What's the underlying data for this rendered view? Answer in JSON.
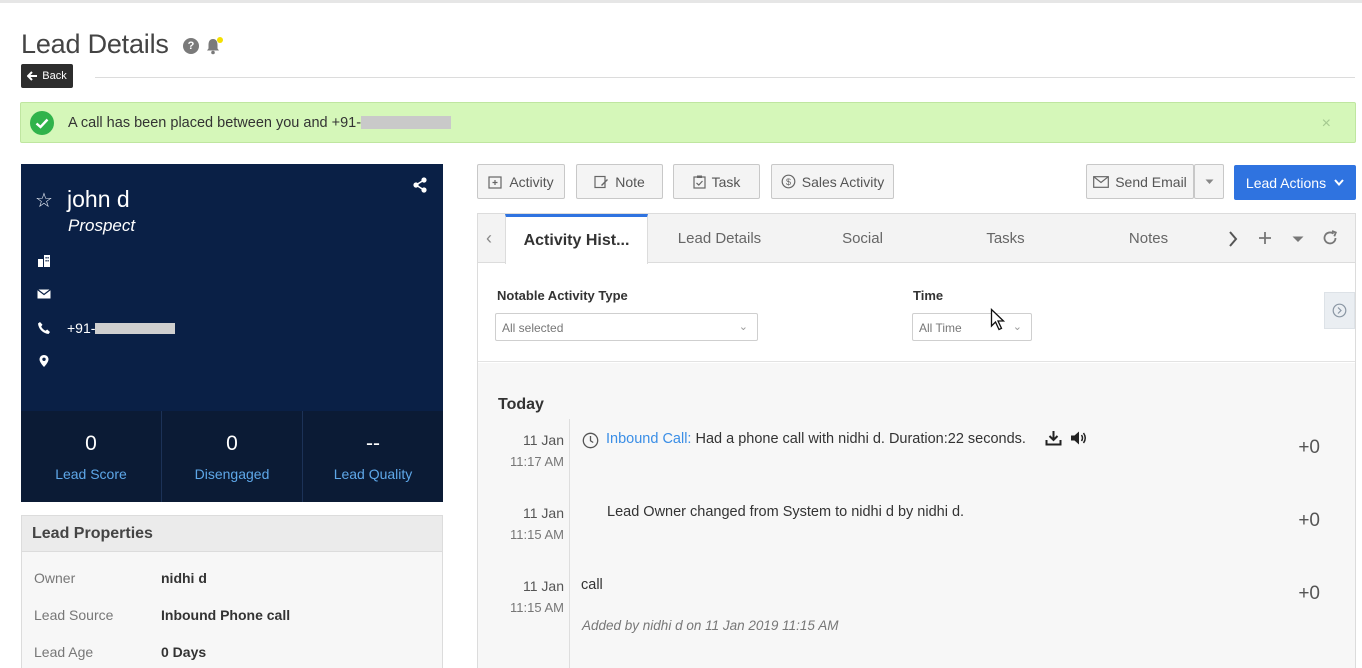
{
  "page": {
    "title": "Lead Details",
    "back_label": "Back"
  },
  "alert": {
    "message": "A call has been placed between you and +91-",
    "close": "×"
  },
  "profile": {
    "name": "john d",
    "stage": "Prospect",
    "phone_prefix": "+91-",
    "stats": [
      {
        "value": "0",
        "label": "Lead Score"
      },
      {
        "value": "0",
        "label": "Disengaged"
      },
      {
        "value": "--",
        "label": "Lead Quality"
      }
    ]
  },
  "properties": {
    "heading": "Lead Properties",
    "rows": [
      {
        "key": "Owner",
        "value": "nidhi d"
      },
      {
        "key": "Lead Source",
        "value": "Inbound Phone call"
      },
      {
        "key": "Lead Age",
        "value": "0 Days"
      }
    ]
  },
  "toolbar": {
    "activity": "Activity",
    "note": "Note",
    "task": "Task",
    "sales_activity": "Sales Activity",
    "send_email": "Send Email",
    "lead_actions": "Lead Actions"
  },
  "tabs": [
    "Activity Hist...",
    "Lead Details",
    "Social",
    "Tasks",
    "Notes"
  ],
  "filters": {
    "type_label": "Notable Activity Type",
    "type_value": "All selected",
    "time_label": "Time",
    "time_value": "All Time"
  },
  "feed": {
    "heading": "Today",
    "items": [
      {
        "date": "11 Jan",
        "time": "11:17 AM",
        "link": "Inbound Call:",
        "text": " Had a phone call with nidhi d. Duration:22 seconds.",
        "score": "+0"
      },
      {
        "date": "11 Jan",
        "time": "11:15 AM",
        "text": "Lead Owner changed from System to nidhi d by nidhi d.",
        "score": "+0"
      },
      {
        "date": "11 Jan",
        "time": "11:15 AM",
        "text": "call",
        "meta": "Added by nidhi d on 11 Jan 2019 11:15 AM",
        "score": "+0"
      }
    ]
  },
  "colors": {
    "profile_bg": "#0a2046",
    "accent": "#2f73e0",
    "success_bg": "#d5f7b9",
    "link": "#3a8ee6"
  }
}
